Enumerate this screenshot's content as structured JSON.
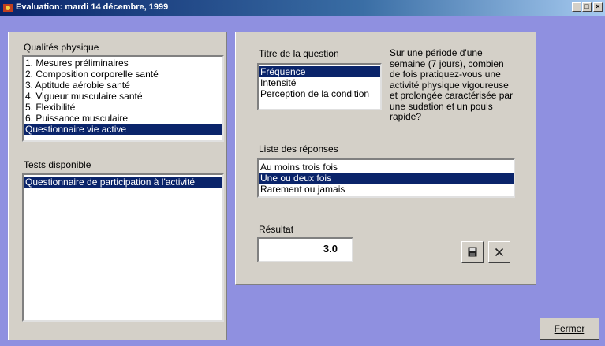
{
  "window": {
    "title": "Evaluation: mardi 14 décembre, 1999",
    "controls": [
      "minimize-icon",
      "maximize-icon",
      "close-icon"
    ]
  },
  "left_panel": {
    "qualities_label": "Qualités physique",
    "qualities": [
      "1. Mesures préliminaires",
      "2. Composition corporelle santé",
      "3. Aptitude aérobie santé",
      "4. Vigueur musculaire santé",
      "5. Flexibilité",
      "6. Puissance musculaire",
      "Questionnaire vie active"
    ],
    "qualities_selected": "Questionnaire vie active",
    "tests_label": "Tests disponible",
    "tests": [
      "Questionnaire de participation à l'activité"
    ],
    "tests_selected": "Questionnaire de participation à l'activité"
  },
  "question_panel": {
    "question_title_label": "Titre de la question",
    "questions": [
      "Fréquence",
      "Intensité",
      "Perception de la condition"
    ],
    "questions_selected": "Fréquence",
    "question_text": "Sur une période d'une\nsemaine (7 jours), combien\nde fois pratiquez-vous une\nactivité physique vigoureuse\net prolongée caractérisée par\nune sudation et un pouls\nrapide?",
    "answers_label": "Liste des réponses",
    "answers": [
      "Au moins trois fois",
      "Une ou deux fois",
      "Rarement ou jamais"
    ],
    "answers_selected": "Une ou deux fois",
    "result_label": "Résultat",
    "result_value": "3.0",
    "save_icon": "save-icon",
    "cancel_icon": "close-x-icon"
  },
  "footer": {
    "close_button_label": "Fermer"
  },
  "colors": {
    "background": "#8f90e0",
    "panel": "#d4d0c8",
    "selection": "#0a246a"
  }
}
